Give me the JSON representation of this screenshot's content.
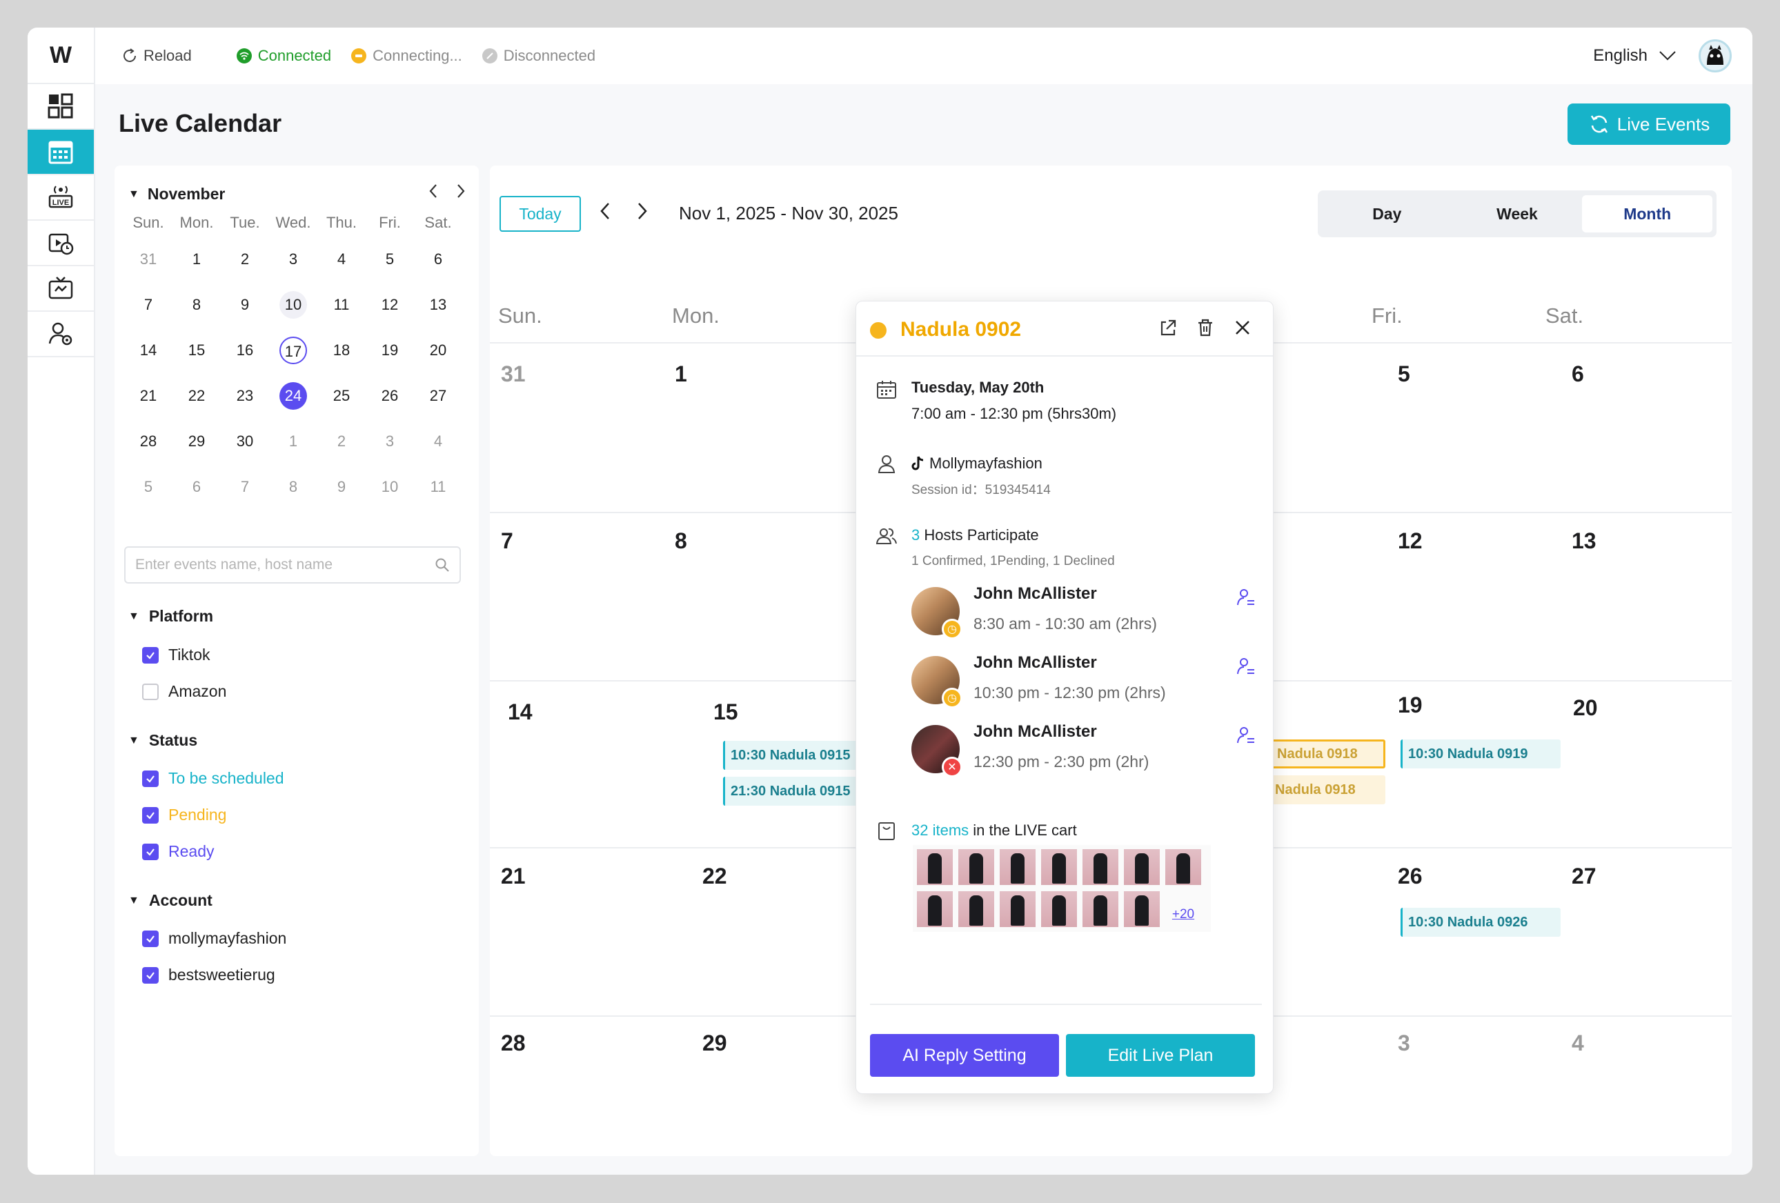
{
  "app": {
    "logo": "W"
  },
  "topbar": {
    "reload": "Reload",
    "connected": "Connected",
    "connecting": "Connecting...",
    "disconnected": "Disconnected",
    "language": "English"
  },
  "page": {
    "title": "Live Calendar",
    "live_events_label": "Live Events"
  },
  "mini_calendar": {
    "month": "November",
    "weekdays": [
      "Sun.",
      "Mon.",
      "Tue.",
      "Wed.",
      "Thu.",
      "Fri.",
      "Sat."
    ],
    "weeks": [
      [
        "31",
        "1",
        "2",
        "3",
        "4",
        "5",
        "6"
      ],
      [
        "7",
        "8",
        "9",
        "10",
        "11",
        "12",
        "13"
      ],
      [
        "14",
        "15",
        "16",
        "17",
        "18",
        "19",
        "20"
      ],
      [
        "21",
        "22",
        "23",
        "24",
        "25",
        "26",
        "27"
      ],
      [
        "28",
        "29",
        "30",
        "1",
        "2",
        "3",
        "4"
      ],
      [
        "5",
        "6",
        "7",
        "8",
        "9",
        "10",
        "11"
      ]
    ]
  },
  "search": {
    "placeholder": "Enter events name, host name"
  },
  "filters": {
    "platform": {
      "title": "Platform",
      "items": [
        {
          "label": "Tiktok",
          "checked": true
        },
        {
          "label": "Amazon",
          "checked": false
        }
      ]
    },
    "status": {
      "title": "Status",
      "items": [
        {
          "label": "To be scheduled",
          "checked": true,
          "color": "#17b3c9"
        },
        {
          "label": "Pending",
          "checked": true,
          "color": "#f6b51e"
        },
        {
          "label": "Ready",
          "checked": true,
          "color": "#5b4cf0"
        }
      ]
    },
    "account": {
      "title": "Account",
      "items": [
        {
          "label": "mollymayfashion",
          "checked": true
        },
        {
          "label": "bestsweetierug",
          "checked": true
        }
      ]
    }
  },
  "calendar": {
    "today_label": "Today",
    "range": "Nov 1, 2025 - Nov 30, 2025",
    "views": [
      "Day",
      "Week",
      "Month"
    ],
    "active_view": "Month",
    "weekdays": [
      "Sun.",
      "Mon.",
      "Fri.",
      "Sat."
    ],
    "days": {
      "r1": [
        "31",
        "1",
        "5",
        "6"
      ],
      "r2": [
        "7",
        "8",
        "12",
        "13"
      ],
      "r3": [
        "14",
        "15",
        "19",
        "20"
      ],
      "r4": [
        "21",
        "22",
        "26",
        "27"
      ],
      "r5": [
        "28",
        "29",
        "3",
        "4"
      ]
    },
    "events": {
      "e1": "10:30 Nadula 0915",
      "e2": "21:30 Nadula 0915",
      "e3": "Nadula 0918",
      "e4": "Nadula 0918",
      "e5": "10:30 Nadula 0919",
      "e6": "10:30 Nadula 0926"
    }
  },
  "popover": {
    "title": "Nadula 0902",
    "date": "Tuesday, May 20th",
    "time": "7:00 am - 12:30 pm  (5hrs30m)",
    "account": "Mollymayfashion",
    "session": "Session id：519345414",
    "hosts_count": "3",
    "hosts_label": "Hosts Participate",
    "hosts_summary": "1 Confirmed, 1Pending, 1 Declined",
    "hosts": [
      {
        "name": "John McAllister",
        "time": "8:30 am - 10:30 am  (2hrs)"
      },
      {
        "name": "John McAllister",
        "time": "10:30 pm - 12:30 pm  (2hrs)"
      },
      {
        "name": "John McAllister",
        "time": "12:30 pm - 2:30 pm  (2hr)"
      }
    ],
    "cart_count": "32 items",
    "cart_label": " in the LIVE cart",
    "more": "+20",
    "ai_button": "AI Reply Setting",
    "edit_button": "Edit Live Plan"
  }
}
